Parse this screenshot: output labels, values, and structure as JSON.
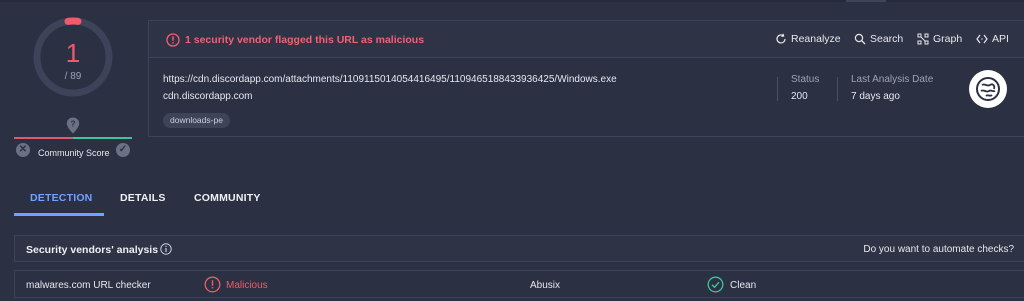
{
  "score": {
    "detections": "1",
    "total": "/ 89"
  },
  "community": {
    "label": "Community Score"
  },
  "alert": {
    "text": "1 security vendor flagged this URL as malicious"
  },
  "actions": [
    {
      "label": "Reanalyze",
      "icon": "refresh-icon"
    },
    {
      "label": "Search",
      "icon": "search-icon"
    },
    {
      "label": "Graph",
      "icon": "graph-icon"
    },
    {
      "label": "API",
      "icon": "api-icon"
    }
  ],
  "url": {
    "full": "https://cdn.discordapp.com/attachments/1109115014054416495/1109465188433936425/Windows.exe",
    "host": "cdn.discordapp.com",
    "tag": "downloads-pe"
  },
  "meta": {
    "status_label": "Status",
    "status_value": "200",
    "date_label": "Last Analysis Date",
    "date_value": "7 days ago"
  },
  "tabs": [
    {
      "label": "DETECTION",
      "active": true
    },
    {
      "label": "DETAILS",
      "active": false
    },
    {
      "label": "COMMUNITY",
      "active": false
    }
  ],
  "vendors": {
    "title": "Security vendors' analysis",
    "automate": "Do you want to automate checks?",
    "rows": [
      {
        "vendor1": "malwares.com URL checker",
        "result1": "Malicious",
        "vendor2": "Abusix",
        "result2": "Clean"
      }
    ]
  },
  "colors": {
    "background": "#2b3042",
    "malicious": "#ee5c6c",
    "clean": "#3fc49a",
    "accent": "#6ea3ff"
  }
}
